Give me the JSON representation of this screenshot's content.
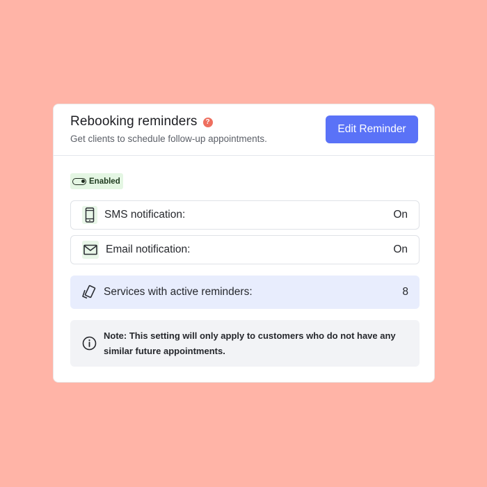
{
  "card": {
    "title": "Rebooking reminders",
    "help_glyph": "?",
    "subtitle": "Get clients to schedule follow-up appointments.",
    "edit_button_label": "Edit Reminder"
  },
  "status_badge": {
    "label": "Enabled",
    "icon": "toggle-on-icon"
  },
  "rows": {
    "sms": {
      "label": "SMS notification:",
      "value": "On",
      "icon": "phone-icon"
    },
    "email": {
      "label": "Email notification:",
      "value": "On",
      "icon": "envelope-icon"
    },
    "services": {
      "label": "Services with active reminders:",
      "value": "8",
      "icon": "cards-icon"
    }
  },
  "note": {
    "text": "Note: This setting will only apply to customers who do not have any similar future appointments.",
    "icon": "info-icon"
  },
  "colors": {
    "background": "#ffb4a7",
    "primary": "#5a72f7",
    "help": "#ee6f5f",
    "enabled_bg": "#e4f6e3",
    "services_bg": "#e8edfd",
    "note_bg": "#f2f3f6"
  }
}
